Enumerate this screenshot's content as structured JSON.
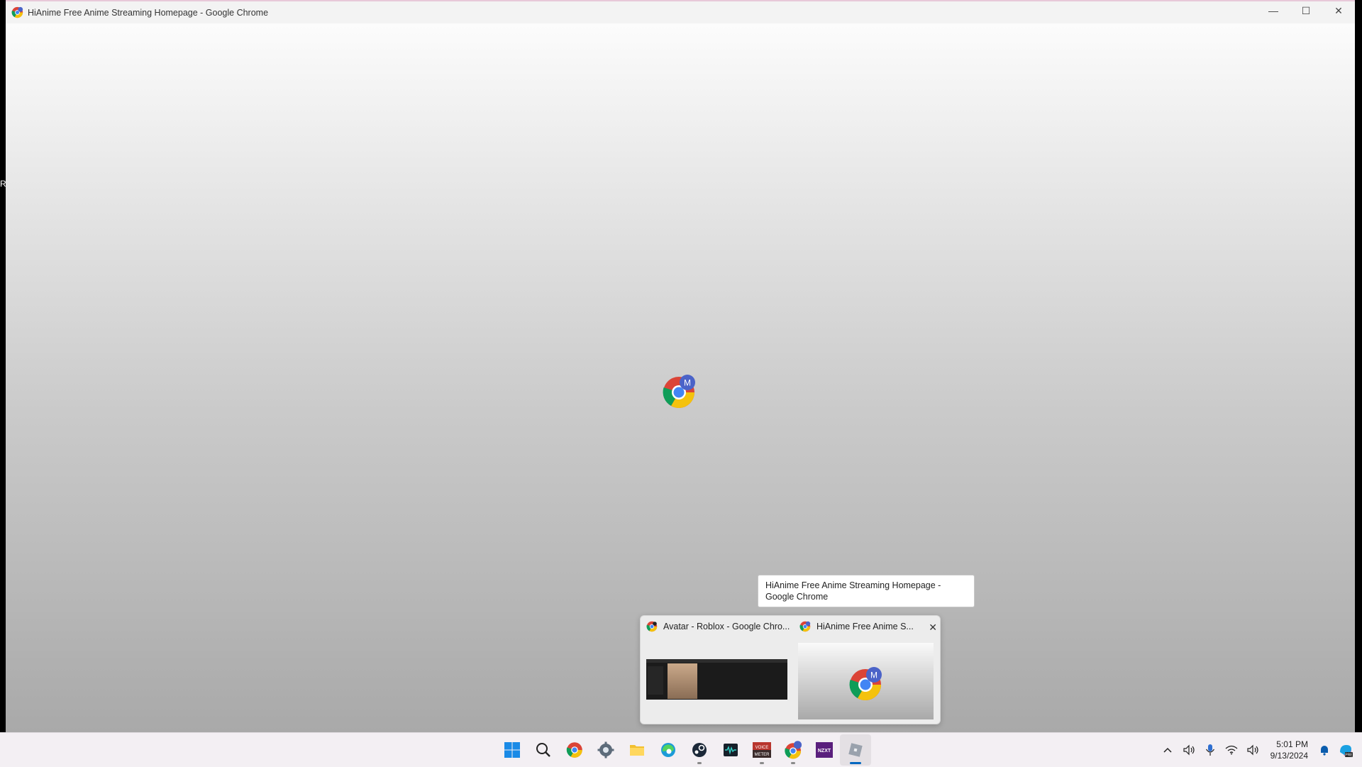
{
  "window": {
    "title": "HiAnime Free Anime Streaming Homepage - Google Chrome",
    "controls": {
      "minimize": "—",
      "maximize": "☐",
      "close": "✕"
    }
  },
  "page": {
    "profile_initial": "M"
  },
  "tooltip": {
    "text": "HiAnime Free Anime Streaming Homepage - Google Chrome"
  },
  "thumbnails": [
    {
      "title": "Avatar - Roblox - Google Chro..."
    },
    {
      "title": "HiAnime Free Anime S...",
      "close": "✕"
    }
  ],
  "taskbar": {
    "apps": [
      {
        "name": "start",
        "icon": "windows-logo-icon"
      },
      {
        "name": "search",
        "icon": "search-icon"
      },
      {
        "name": "chrome",
        "icon": "chrome-icon"
      },
      {
        "name": "settings",
        "icon": "gear-icon"
      },
      {
        "name": "file-explorer",
        "icon": "folder-icon"
      },
      {
        "name": "edge",
        "icon": "edge-icon"
      },
      {
        "name": "steam",
        "icon": "steam-icon"
      },
      {
        "name": "audio-app",
        "icon": "waveform-icon"
      },
      {
        "name": "voicemeeter",
        "icon": "voicemeeter-icon",
        "label": "VOICE METER"
      },
      {
        "name": "chrome-profile",
        "icon": "chrome-profile-icon"
      },
      {
        "name": "nzxt",
        "icon": "nzxt-icon",
        "label": "NZXT"
      },
      {
        "name": "roblox",
        "icon": "roblox-icon"
      }
    ],
    "clock": {
      "time": "5:01 PM",
      "date": "9/13/2024"
    }
  },
  "colors": {
    "accent": "#0067c0",
    "titlebar": "#f3f3f3",
    "taskbar": "#f3eff3"
  }
}
